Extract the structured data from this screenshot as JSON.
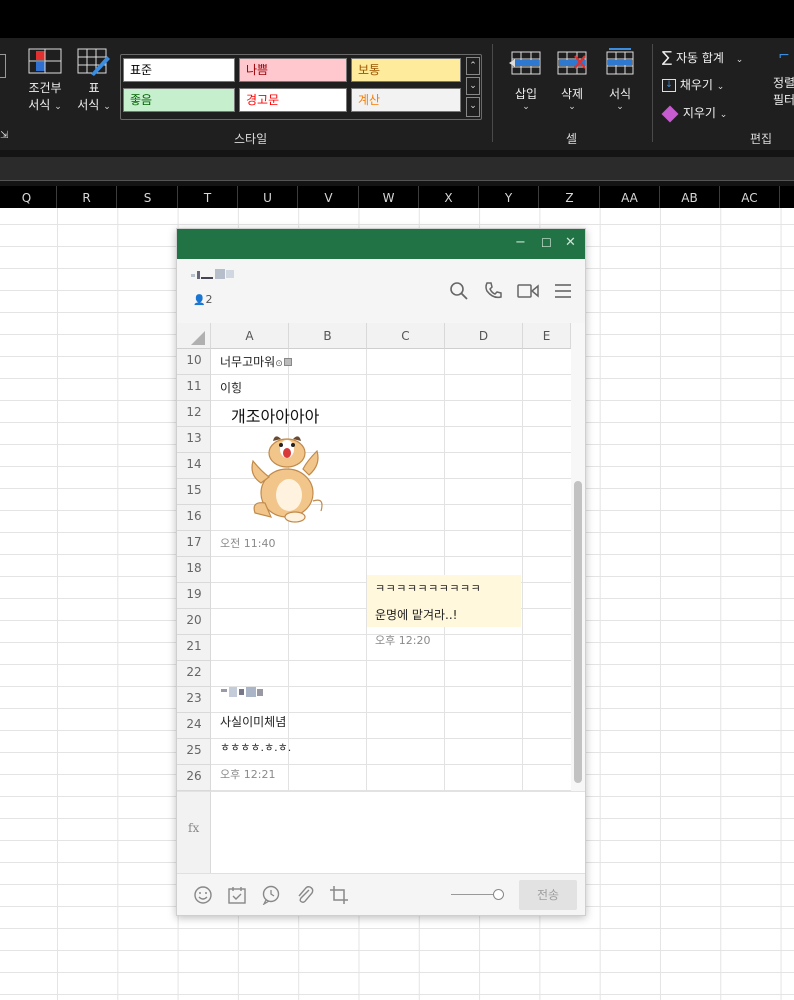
{
  "ribbon": {
    "conditional_format": {
      "line1": "조건부",
      "line2": "서식"
    },
    "table_format": {
      "line1": "표",
      "line2": "서식"
    },
    "styles": [
      {
        "label": "표준",
        "bg": "#ffffff",
        "color": "#000000"
      },
      {
        "label": "나쁨",
        "bg": "#ffc7ce",
        "color": "#9c0006"
      },
      {
        "label": "보통",
        "bg": "#ffeb9c",
        "color": "#9c5700"
      },
      {
        "label": "좋음",
        "bg": "#c6efce",
        "color": "#006100"
      },
      {
        "label": "경고문",
        "bg": "#ffffff",
        "color": "#ff0000"
      },
      {
        "label": "계산",
        "bg": "#f2f2f2",
        "color": "#fa7d00"
      }
    ],
    "styles_group": "스타일",
    "insert": "삽입",
    "delete": "삭제",
    "format": "서식",
    "cells_group": "셀",
    "autosum": "자동 합계",
    "fill": "채우기",
    "clear": "지우기",
    "sort_line1": "정렬",
    "sort_line2": "필터",
    "edit_group": "편집"
  },
  "columns": [
    "Q",
    "R",
    "S",
    "T",
    "U",
    "V",
    "W",
    "X",
    "Y",
    "Z",
    "AA",
    "AB",
    "AC"
  ],
  "chat": {
    "member_count": "2",
    "sheet_columns": [
      "A",
      "B",
      "C",
      "D",
      "E"
    ],
    "rows": [
      {
        "num": "10",
        "text": "너무고마워",
        "col": "A",
        "kind": "msg"
      },
      {
        "num": "11",
        "text": "이힝",
        "col": "A",
        "kind": "msg"
      },
      {
        "num": "12",
        "text": "개조아아아아",
        "col": "A",
        "kind": "big"
      },
      {
        "num": "13",
        "text": "",
        "col": "A",
        "kind": "empty"
      },
      {
        "num": "14",
        "text": "",
        "col": "A",
        "kind": "empty"
      },
      {
        "num": "15",
        "text": "",
        "col": "A",
        "kind": "empty"
      },
      {
        "num": "16",
        "text": "",
        "col": "A",
        "kind": "empty"
      },
      {
        "num": "17",
        "text": "오전 11:40",
        "col": "A",
        "kind": "time"
      },
      {
        "num": "18",
        "text": "",
        "col": "A",
        "kind": "empty"
      },
      {
        "num": "19",
        "text": "ㅋㅋㅋㅋㅋㅋㅋㅋㅋㅋ",
        "col": "C",
        "kind": "mine"
      },
      {
        "num": "20",
        "text": "운명에 맡겨라..!",
        "col": "C",
        "kind": "mine"
      },
      {
        "num": "21",
        "text": "오후 12:20",
        "col": "C",
        "kind": "time"
      },
      {
        "num": "22",
        "text": "",
        "col": "A",
        "kind": "empty"
      },
      {
        "num": "23",
        "text": "",
        "col": "A",
        "kind": "name"
      },
      {
        "num": "24",
        "text": "사실이미체념",
        "col": "A",
        "kind": "msg"
      },
      {
        "num": "25",
        "text": "ㅎㅎㅎㅎ.ㅎ.ㅎ.",
        "col": "A",
        "kind": "msg"
      },
      {
        "num": "26",
        "text": "오후 12:21",
        "col": "A",
        "kind": "time"
      }
    ],
    "fx_label": "fx",
    "send_label": "전송"
  }
}
